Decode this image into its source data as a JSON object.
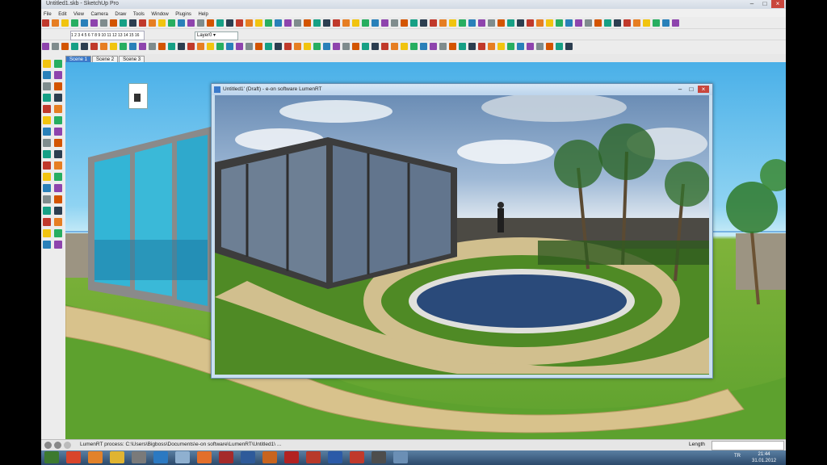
{
  "app": {
    "title": "Untitled1.skb - SketchUp Pro",
    "menu": [
      "File",
      "Edit",
      "View",
      "Camera",
      "Draw",
      "Tools",
      "Window",
      "Plugins",
      "Help"
    ],
    "layer_value": "Layer0",
    "ruler_text": "1 2 3 4 5 6 7 8 9 10 11 12 13 14 15 16",
    "scene_tabs": [
      "Scene 1",
      "Scene 2",
      "Scene 3"
    ],
    "status_text": "LumenRT process: C:\\Users\\Bigboss\\Documents\\e-on software\\LumenRT\\Untitled1\\ ...",
    "length_label": "Length",
    "length_value": ""
  },
  "lumen_window": {
    "title": "Untitled1' (Draft) - e-on software LumenRT"
  },
  "taskbar": {
    "apps": [
      "start-icon",
      "chrome-icon",
      "firefox-icon",
      "explorer-icon",
      "media-icon",
      "teamviewer-icon",
      "paint-icon",
      "mail-icon",
      "sketchup-icon",
      "photoshop-icon",
      "illustrator-icon",
      "acrobat-icon",
      "filezilla-icon",
      "word-icon",
      "opera-icon",
      "sketchup2-icon",
      "lumenrt-icon"
    ],
    "language": "TR",
    "time": "21:44",
    "date": "31.01.2012"
  },
  "colors": {
    "sky": "#4ab0e8",
    "grass": "#5da12e",
    "path_stone": "#d8c28c",
    "glass": "#33b5d6",
    "pool_water": "#2a4a7a",
    "taskbar": "#2c4a6b",
    "active_tab": "#3b79c9"
  }
}
